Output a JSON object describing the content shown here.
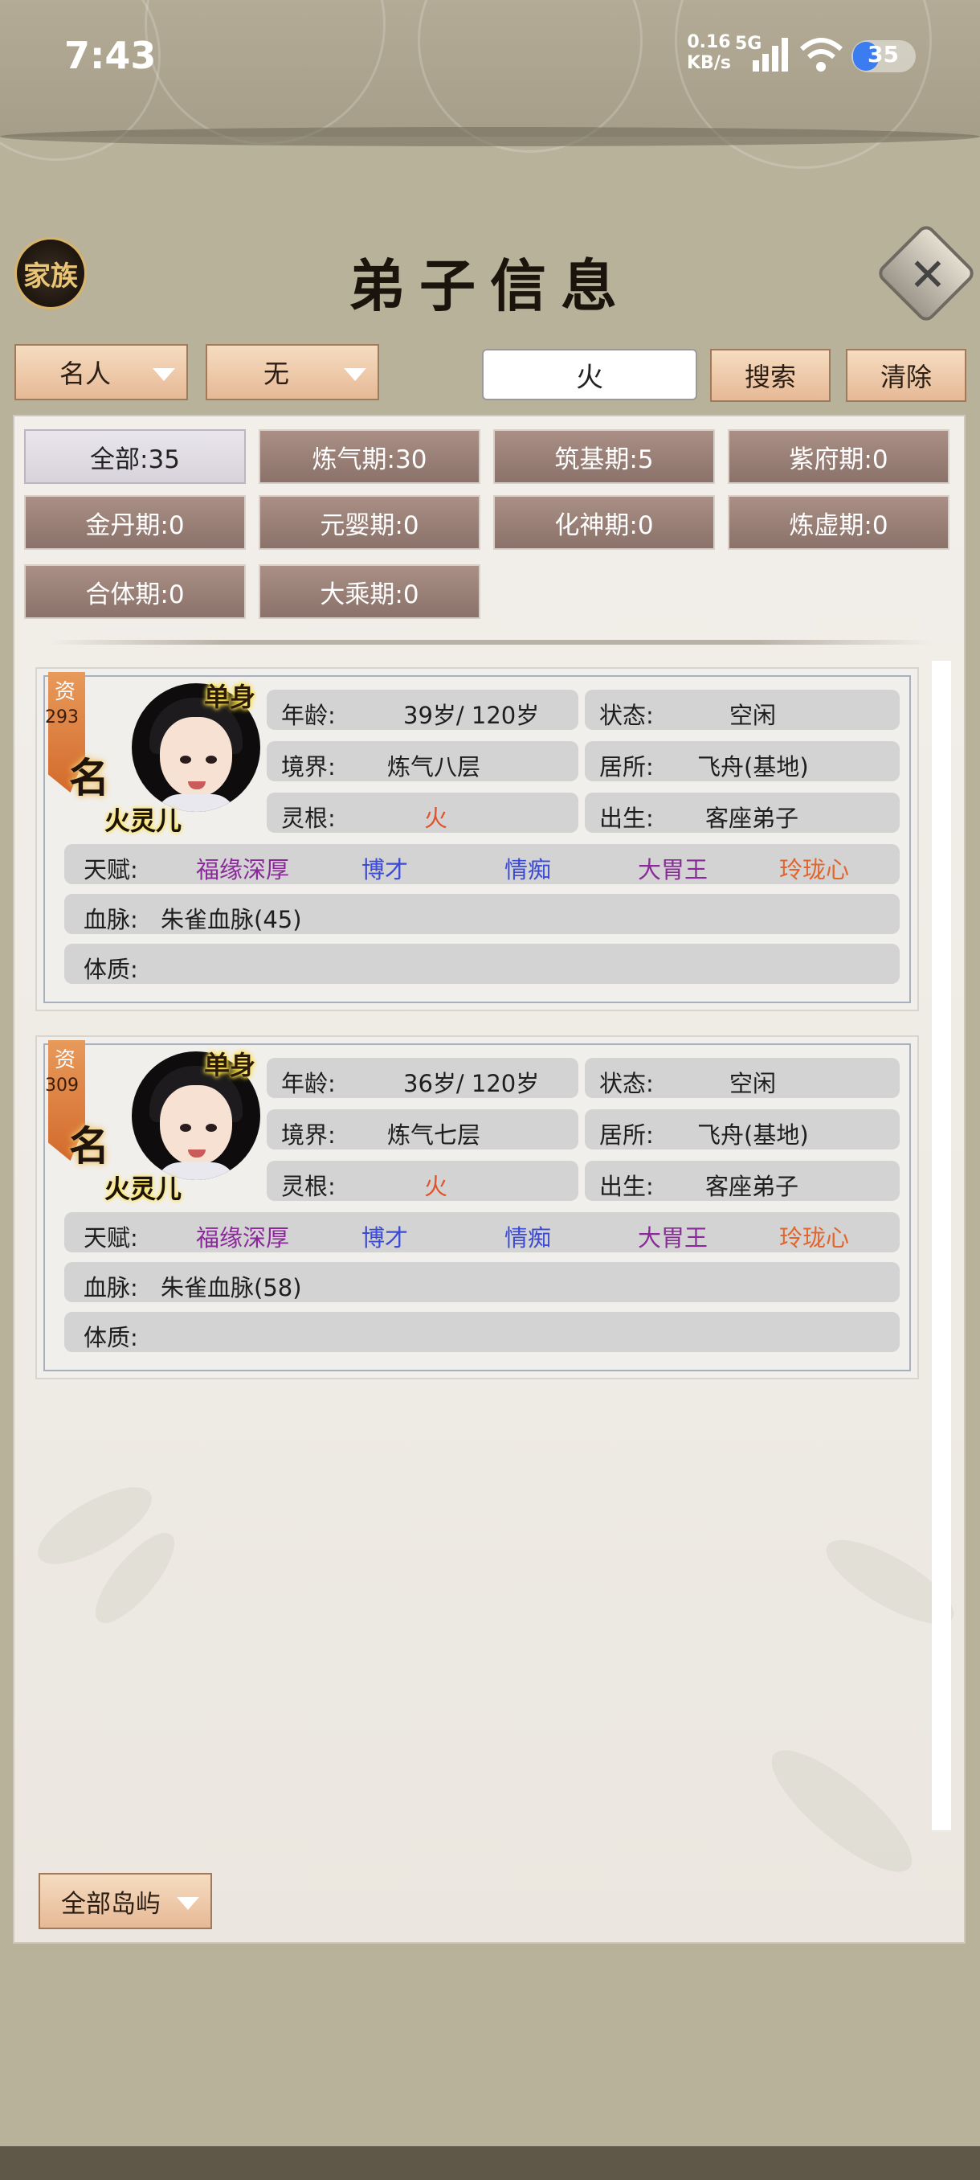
{
  "status_bar": {
    "time": "7:43",
    "net_speed": "0.16",
    "net_unit": "KB/s",
    "network": "5G",
    "battery": "35"
  },
  "header": {
    "family_label": "家族",
    "title": "弟子信息"
  },
  "filters": {
    "dropdown1": "名人",
    "dropdown2": "无",
    "search_value": "火",
    "search_label": "搜索",
    "clear_label": "清除"
  },
  "stages": [
    {
      "label": "全部:35",
      "active": true
    },
    {
      "label": "炼气期:30"
    },
    {
      "label": "筑基期:5"
    },
    {
      "label": "紫府期:0"
    },
    {
      "label": "金丹期:0"
    },
    {
      "label": "元婴期:0"
    },
    {
      "label": "化神期:0"
    },
    {
      "label": "炼虚期:0"
    },
    {
      "label": "合体期:0"
    },
    {
      "label": "大乘期:0"
    }
  ],
  "labels": {
    "age": "年龄:",
    "status": "状态:",
    "realm": "境界:",
    "residence": "居所:",
    "root": "灵根:",
    "birth": "出生:",
    "talent": "天赋:",
    "blood": "血脉:",
    "body": "体质:"
  },
  "disciples": [
    {
      "badge_char": "资",
      "aptitude": "293",
      "fame_char": "名",
      "single": "单身",
      "name": "火灵儿",
      "age": "39岁/ 120岁",
      "status": "空闲",
      "realm": "炼气八层",
      "residence": "飞舟(基地)",
      "root": "火",
      "birth": "客座弟子",
      "talents": [
        "福缘深厚",
        "博才",
        "情痴",
        "大胃王",
        "玲珑心"
      ],
      "bloodline": "朱雀血脉(45)",
      "physique": ""
    },
    {
      "badge_char": "资",
      "aptitude": "309",
      "fame_char": "名",
      "single": "单身",
      "name": "火灵儿",
      "age": "36岁/ 120岁",
      "status": "空闲",
      "realm": "炼气七层",
      "residence": "飞舟(基地)",
      "root": "火",
      "birth": "客座弟子",
      "talents": [
        "福缘深厚",
        "博才",
        "情痴",
        "大胃王",
        "玲珑心"
      ],
      "bloodline": "朱雀血脉(58)",
      "physique": ""
    }
  ],
  "colors": {
    "talent_purple": "#8a2a9a",
    "talent_blue": "#3b4bd6",
    "talent_orange": "#e0652e",
    "root_red": "#e0542c"
  },
  "footer": {
    "island_label": "全部岛屿"
  }
}
